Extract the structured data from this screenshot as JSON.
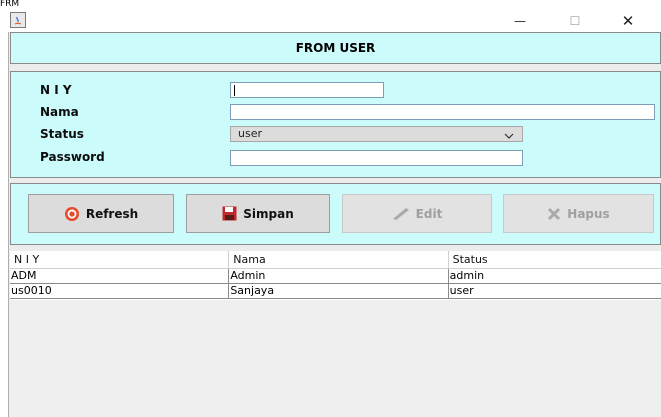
{
  "window": {
    "caption": "FRM",
    "minimize_glyph": "—",
    "maximize_glyph": "☐",
    "close_glyph": "✕"
  },
  "header": {
    "title": "FROM USER"
  },
  "form": {
    "niy_label": "N I Y",
    "niy_value": "",
    "nama_label": "Nama",
    "nama_value": "",
    "status_label": "Status",
    "status_value": "user",
    "password_label": "Password",
    "password_value": ""
  },
  "buttons": {
    "refresh": "Refresh",
    "simpan": "Simpan",
    "edit": "Edit",
    "hapus": "Hapus"
  },
  "table": {
    "columns": [
      "N I Y",
      "Nama",
      "Status"
    ],
    "rows": [
      [
        "ADM",
        "Admin",
        "admin"
      ],
      [
        "us0010",
        "Sanjaya",
        "user"
      ]
    ]
  },
  "colors": {
    "panel_bg": "#ccfbfb",
    "window_bg": "#ececec",
    "accent_red": "#e24b2b"
  }
}
